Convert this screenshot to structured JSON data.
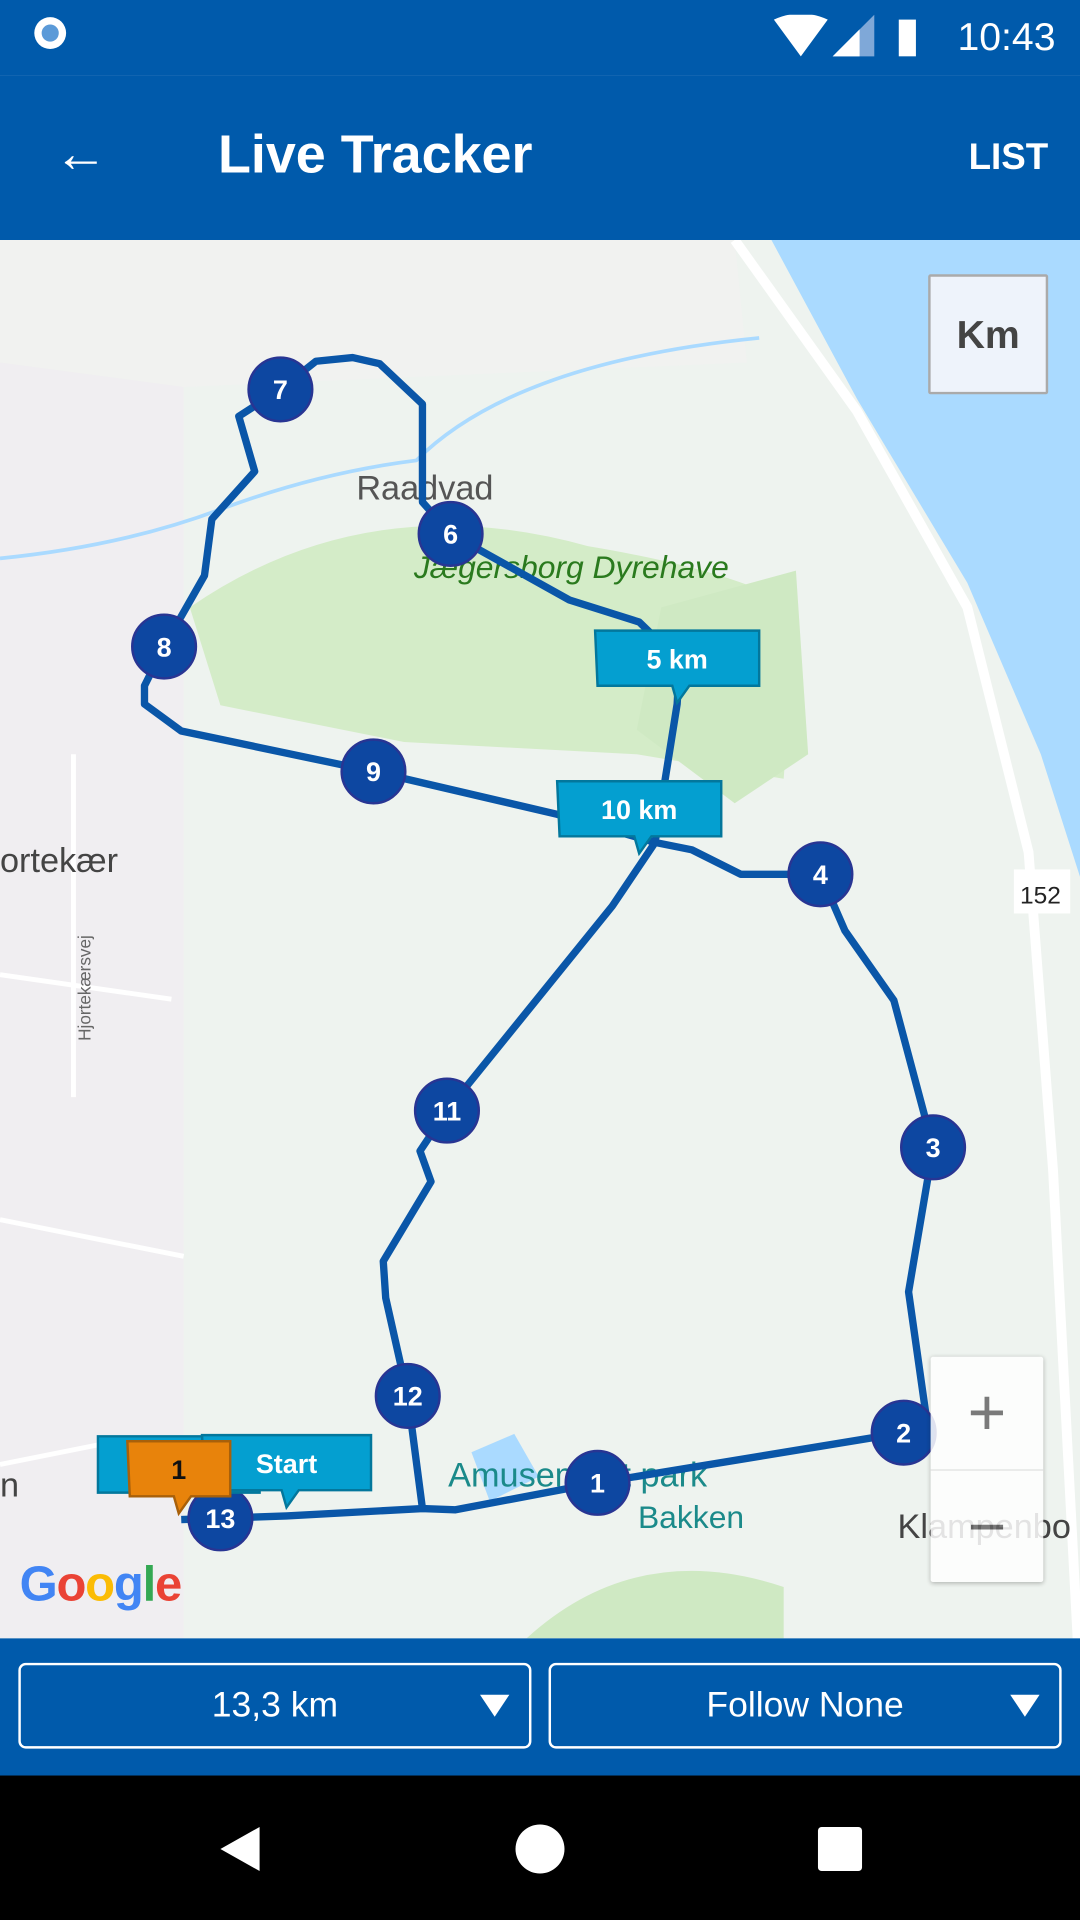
{
  "status_bar": {
    "time": "10:43"
  },
  "app_bar": {
    "title": "Live Tracker",
    "list_label": "LIST",
    "back_icon": "arrow-left-icon"
  },
  "map": {
    "unit_button": "Km",
    "place_labels": [
      "Raadvad",
      "Jægersborg Dyrehave",
      "ortekær",
      "Hjortekærsvej",
      "Amusement park",
      "Bakken",
      "Klampenbo",
      "152",
      "n"
    ],
    "google_logo": "Google",
    "route_color": "#0a56a8",
    "checkpoints": [
      "1",
      "2",
      "3",
      "4",
      "6",
      "7",
      "8",
      "9",
      "11",
      "12",
      "13"
    ],
    "distance_flags": [
      "5 km",
      "10 km"
    ],
    "start_flag": "Start",
    "participant_marker": "1",
    "zoom_in": "+",
    "zoom_out": "−"
  },
  "bottom_bar": {
    "distance_select": "13,3 km",
    "follow_select": "Follow None"
  }
}
